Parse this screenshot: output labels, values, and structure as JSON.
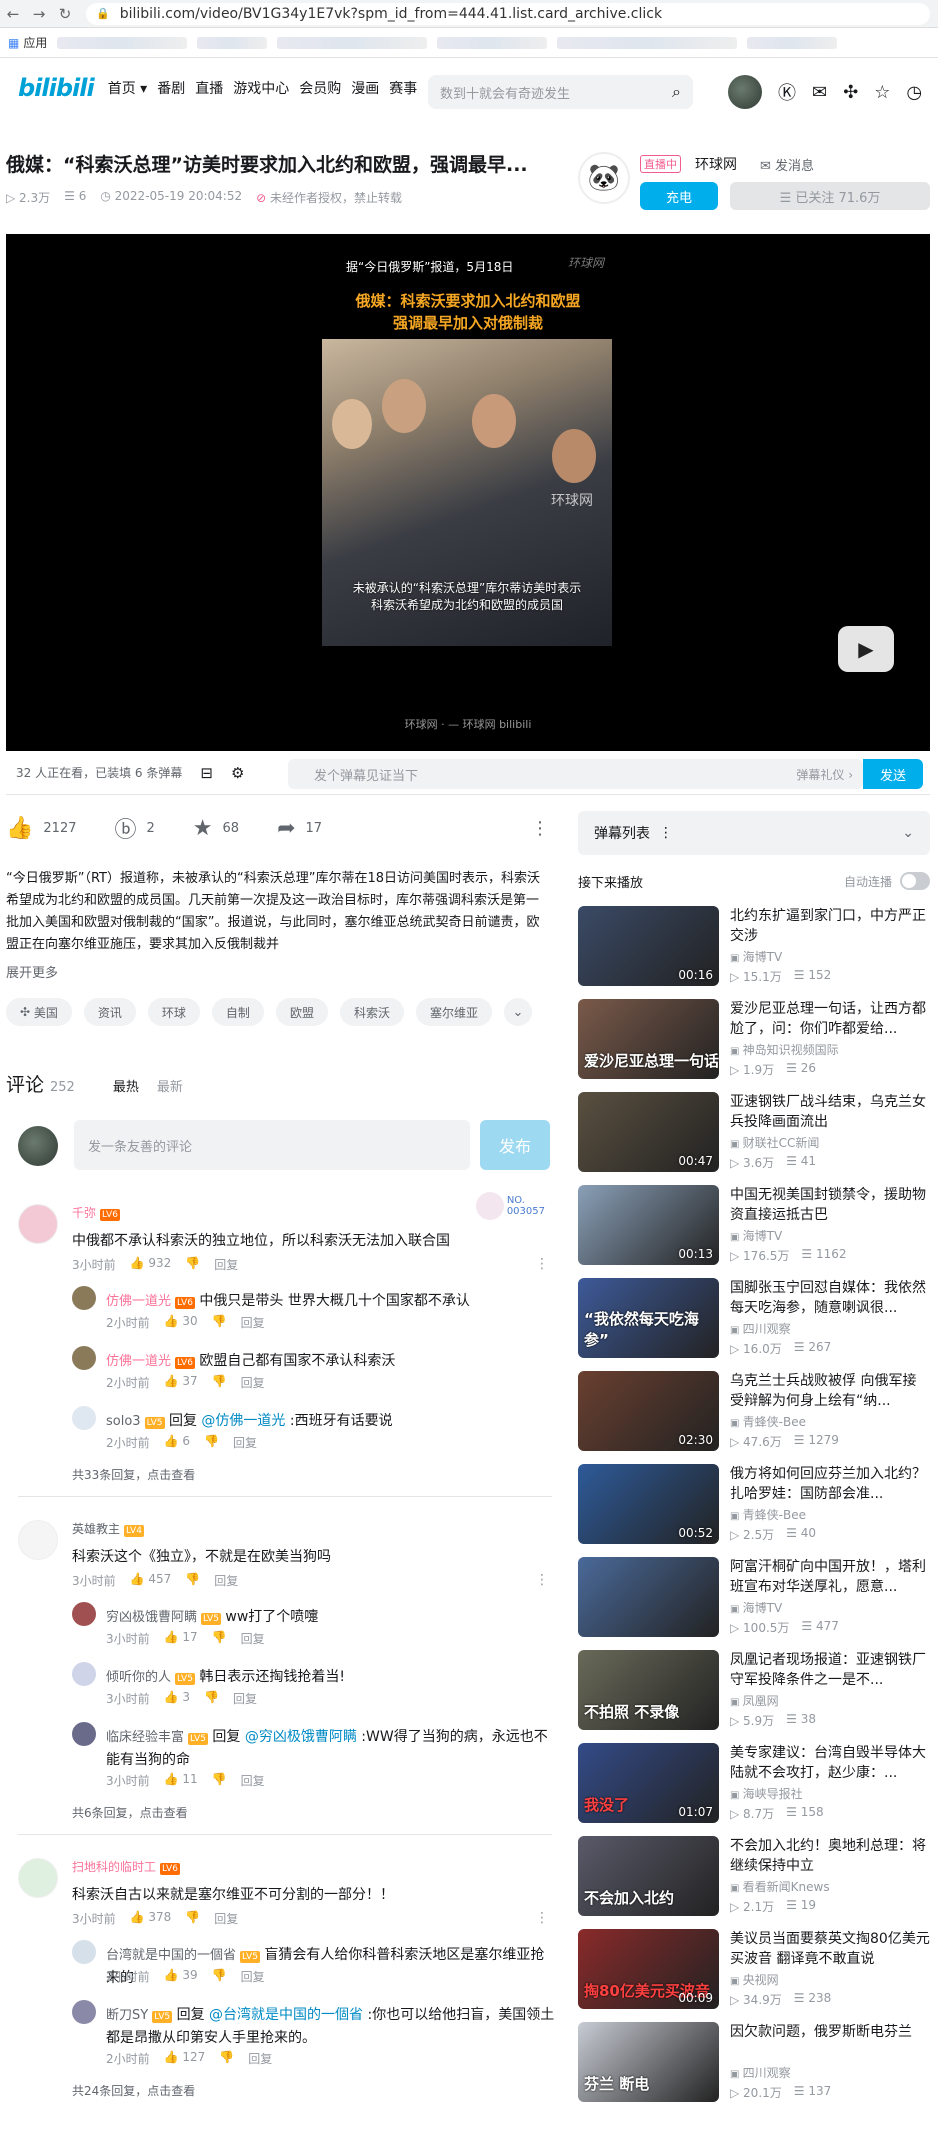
{
  "browser": {
    "url": "bilibili.com/video/BV1G34y1E7vk?spm_id_from=444.41.list.card_archive.click",
    "bookmarks_label": "应用"
  },
  "header": {
    "logo": "bilibili",
    "nav": [
      "首页 ▾",
      "番剧",
      "直播",
      "游戏中心",
      "会员购",
      "漫画",
      "赛事"
    ],
    "search_placeholder": "数到十就会有奇迹发生"
  },
  "video": {
    "title": "俄媒：“科索沃总理”访美时要求加入北约和欧盟，强调最早...",
    "views": "2.3万",
    "danmaku": "6",
    "date": "2022-05-19 20:04:52",
    "notice": "未经作者授权，禁止转载"
  },
  "uploader": {
    "live_badge": "直播中",
    "name": "环球网",
    "message": "发消息",
    "charge": "充电",
    "follow": "☰ 已关注 71.6万"
  },
  "player": {
    "source_line": "据“今日俄罗斯”报道，5月18日",
    "channel_logo": "环球网",
    "headline_1": "俄媒：科索沃要求加入北约和欧盟",
    "headline_2": "强调最早加入对俄制裁",
    "watermark": "环球网",
    "subtitle_1": "未被承认的“科索沃总理”库尔蒂访美时表示",
    "subtitle_2": "科索沃希望成为北约和欧盟的成员国",
    "bottom": "环球网 · — 环球网 bilibili"
  },
  "danmaku_bar": {
    "watching": "32 人正在看，已装填 6 条弹幕",
    "placeholder": "发个弹幕见证当下",
    "etiquette": "弹幕礼仪 ›",
    "send": "发送"
  },
  "actions": {
    "like": "2127",
    "coin": "2",
    "favorite": "68",
    "share": "17"
  },
  "description": "“今日俄罗斯”（RT）报道称，未被承认的“科索沃总理”库尔蒂在18日访问美国时表示，科索沃希望成为北约和欧盟的成员国。几天前第一次提及这一政治目标时，库尔蒂强调科索沃是第一批加入美国和欧盟对俄制裁的“国家”。报道说，与此同时，塞尔维亚总统武契奇日前谴责，欧盟正在向塞尔维亚施压，要求其加入反俄制裁并",
  "expand": "展开更多",
  "tags": [
    "美国",
    "资讯",
    "环球",
    "自制",
    "欧盟",
    "科索沃",
    "塞尔维亚"
  ],
  "comments": {
    "title": "评论",
    "count": "252",
    "sort_hot": "最热",
    "sort_new": "最新",
    "placeholder": "发一条友善的评论",
    "post": "发布",
    "reply_label": "回复",
    "fan_badge": "NO.\n003057",
    "threads": [
      {
        "user": "千弥",
        "level": "LV6",
        "name_color": "#fb7299",
        "text": "中俄都不承认科索沃的独立地位，所以科索沃无法加入联合国",
        "time": "3小时前",
        "likes": "932",
        "replies": [
          {
            "user": "仿佛一道光",
            "level": "LV6",
            "prefix": "",
            "at": "",
            "text": "中俄只是带头 世界大概几十个国家都不承认",
            "time": "2小时前",
            "likes": "30"
          },
          {
            "user": "仿佛一道光",
            "level": "LV6",
            "prefix": "",
            "at": "",
            "text": "欧盟自己都有国家不承认科索沃",
            "time": "2小时前",
            "likes": "37"
          },
          {
            "user": "solo3",
            "level": "LV5",
            "prefix": "回复",
            "at": "@仿佛一道光",
            "text": ":西班牙有话要说",
            "time": "2小时前",
            "likes": "6"
          }
        ],
        "view_all": "共33条回复，点击查看"
      },
      {
        "user": "英雄教主",
        "level": "LV4",
        "name_color": "#61666d",
        "text": "科索沃这个《独立》，不就是在欧美当狗吗",
        "time": "3小时前",
        "likes": "457",
        "replies": [
          {
            "user": "穷凶极饿曹阿瞒",
            "level": "LV5",
            "prefix": "",
            "at": "",
            "text": "ww打了个喷嚏",
            "time": "3小时前",
            "likes": "17"
          },
          {
            "user": "倾听你的人",
            "level": "LV5",
            "prefix": "",
            "at": "",
            "text": "韩日表示还掏钱抢着当!",
            "time": "3小时前",
            "likes": "3"
          },
          {
            "user": "临床经验丰富",
            "level": "LV5",
            "prefix": "回复",
            "at": "@穷凶极饿曹阿瞒",
            "text": ":WW得了当狗的病，永远也不能有当狗的命",
            "time": "3小时前",
            "likes": "11"
          }
        ],
        "view_all": "共6条回复，点击查看"
      },
      {
        "user": "扫地科的临时工",
        "level": "LV6",
        "name_color": "#fb7299",
        "text": "科索沃自古以来就是塞尔维亚不可分割的一部分！！",
        "time": "3小时前",
        "likes": "378",
        "replies": [
          {
            "user": "台湾就是中国的一個省",
            "level": "LV5",
            "prefix": "",
            "at": "",
            "text": "盲猜会有人给你科普科索沃地区是塞尔维亚抢来的",
            "time": "2小时前",
            "likes": "39"
          },
          {
            "user": "断刀SY",
            "level": "LV5",
            "prefix": "回复",
            "at": "@台湾就是中国的一個省",
            "text": ":你也可以给他扫盲，美国领土都是昂撒从印第安人手里抢来的。",
            "time": "2小时前",
            "likes": "127"
          }
        ],
        "view_all": "共24条回复，点击查看"
      }
    ]
  },
  "sidebar": {
    "danmaku_list": "弹幕列表",
    "next_up": "接下来播放",
    "autoplay": "自动连播",
    "items": [
      {
        "title": "北约东扩逼到家门口，中方严正交涉",
        "up": "海博TV",
        "views": "15.1万",
        "dm": "152",
        "duration": "00:16",
        "caption": "",
        "thumb": "#3a4a66"
      },
      {
        "title": "爱沙尼亚总理一句话，让西方都尬了，问：你们咋都爱给...",
        "up": "神岛知识视频国际",
        "views": "1.9万",
        "dm": "26",
        "duration": "",
        "caption": "爱沙尼亚总理一句话",
        "thumb": "#7a5a4a"
      },
      {
        "title": "亚速钢铁厂战斗结束，乌克兰女兵投降画面流出",
        "up": "财联社CC新闻",
        "views": "3.6万",
        "dm": "41",
        "duration": "00:47",
        "caption": "",
        "thumb": "#5a5040"
      },
      {
        "title": "中国无视美国封锁禁令，援助物资直接运抵古巴",
        "up": "海博TV",
        "views": "176.5万",
        "dm": "1162",
        "duration": "00:13",
        "caption": "",
        "thumb": "#8aa0b8"
      },
      {
        "title": "国脚张玉宁回怼自媒体：我依然每天吃海参，随意喇讽很...",
        "up": "四川观察",
        "views": "16.0万",
        "dm": "267",
        "duration": "",
        "caption": "“我依然每天吃海参”",
        "thumb": "#3d5a99"
      },
      {
        "title": "乌克兰士兵战败被俘 向俄军接受辩解为何身上绘有“纳...",
        "up": "青蜂侠-Bee",
        "views": "47.6万",
        "dm": "1279",
        "duration": "02:30",
        "caption": "",
        "thumb": "#6a4030"
      },
      {
        "title": "俄方将如何回应芬兰加入北约？扎哈罗娃：国防部会准...",
        "up": "青蜂侠-Bee",
        "views": "2.5万",
        "dm": "40",
        "duration": "00:52",
        "caption": "",
        "thumb": "#2e5b9a"
      },
      {
        "title": "阿富汗桐矿向中国开放！，塔利班宣布对华送厚礼，愿意...",
        "up": "海博TV",
        "views": "100.5万",
        "dm": "477",
        "duration": "",
        "caption": "",
        "thumb": "#4a6a9a"
      },
      {
        "title": "凤凰记者现场报道：亚速钢铁厂守军投降条件之一是不...",
        "up": "凤凰网",
        "views": "5.9万",
        "dm": "38",
        "duration": "",
        "caption": "不拍照 不录像",
        "thumb": "#6a6a5a"
      },
      {
        "title": "美专家建议：台湾自毁半导体大陆就不会攻打，赵少康：...",
        "up": "海峡导报社",
        "views": "8.7万",
        "dm": "158",
        "duration": "01:07",
        "caption": "我没了",
        "thumb": "#334b88"
      },
      {
        "title": "不会加入北约！奥地利总理：将继续保持中立",
        "up": "看看新闻Knews",
        "views": "2.1万",
        "dm": "19",
        "duration": "",
        "caption": "不会加入北约",
        "thumb": "#5a5a6a"
      },
      {
        "title": "美议员当面要蔡英文掏80亿美元买波音 翻译竟不敢直说",
        "up": "央视网",
        "views": "34.9万",
        "dm": "238",
        "duration": "00:09",
        "caption": "掏80亿美元买波音",
        "thumb": "#8a2a2a"
      },
      {
        "title": "因欠款问题，俄罗斯断电芬兰",
        "up": "四川观察",
        "views": "20.1万",
        "dm": "137",
        "duration": "",
        "caption": "芬兰 断电",
        "thumb": "#c8ccd4"
      }
    ]
  }
}
